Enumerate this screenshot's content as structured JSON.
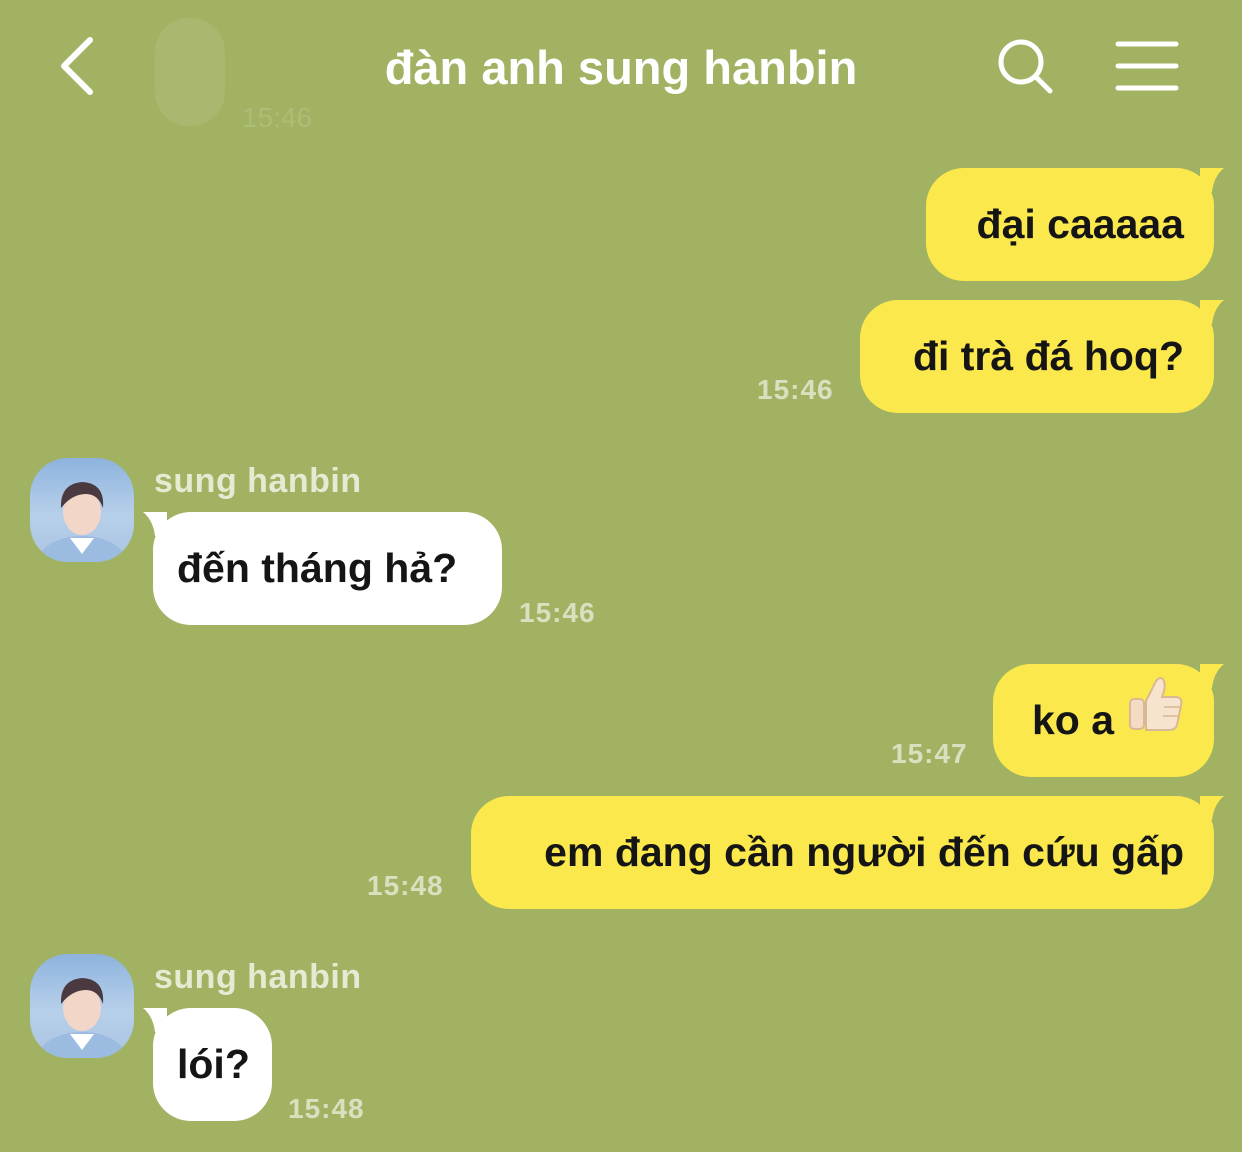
{
  "header": {
    "title": "đàn anh sung hanbin",
    "ghost_time": "15:46"
  },
  "messages": [
    {
      "side": "out",
      "text": "đại caaaaa"
    },
    {
      "side": "out",
      "text": "đi trà đá hoq?",
      "time": "15:46"
    },
    {
      "side": "in",
      "sender": "sung hanbin",
      "text": "đến tháng hả?",
      "time": "15:46"
    },
    {
      "side": "out",
      "text": "ko a",
      "emoji": "thumbs-up",
      "time": "15:47"
    },
    {
      "side": "out",
      "text": "em đang cần người đến cứu gấp",
      "time": "15:48"
    },
    {
      "side": "in",
      "sender": "sung hanbin",
      "text": "lói?",
      "time": "15:48"
    }
  ],
  "icons": [
    "back-arrow-icon",
    "search-icon",
    "menu-icon",
    "thumbs-up-icon"
  ],
  "colors": {
    "background": "#a1b262",
    "outgoing_bubble": "#fae84c",
    "incoming_bubble": "#ffffff"
  }
}
